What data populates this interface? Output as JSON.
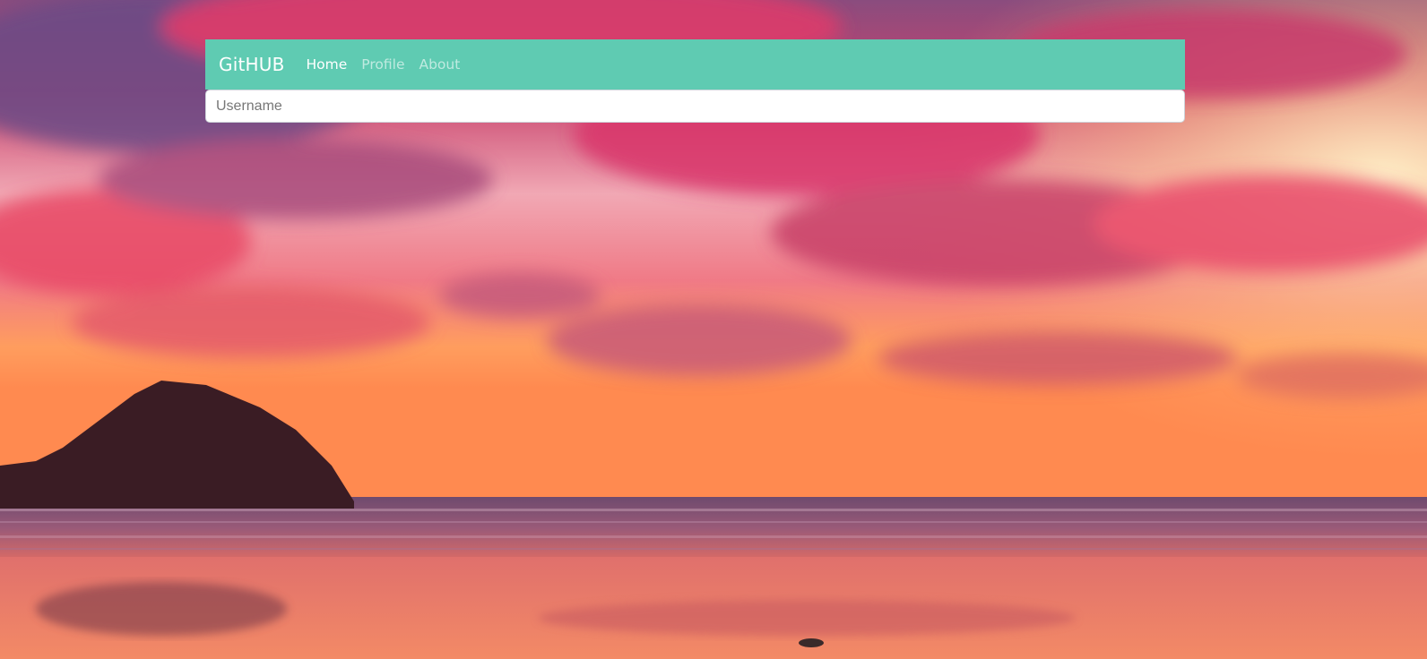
{
  "background": {
    "description_colors": {
      "sky_top": "#7a5a8c",
      "sky_mid": "#e8506e",
      "horizon": "#ff9a4a",
      "sea": "#7a4a6a",
      "sand": "#f07058"
    }
  },
  "navbar": {
    "brand": "GitHUB",
    "links": [
      {
        "label": "Home",
        "active": true
      },
      {
        "label": "Profile",
        "active": false
      },
      {
        "label": "About",
        "active": false
      }
    ],
    "color": "#5fcbb2"
  },
  "search": {
    "placeholder": "Username",
    "value": ""
  }
}
